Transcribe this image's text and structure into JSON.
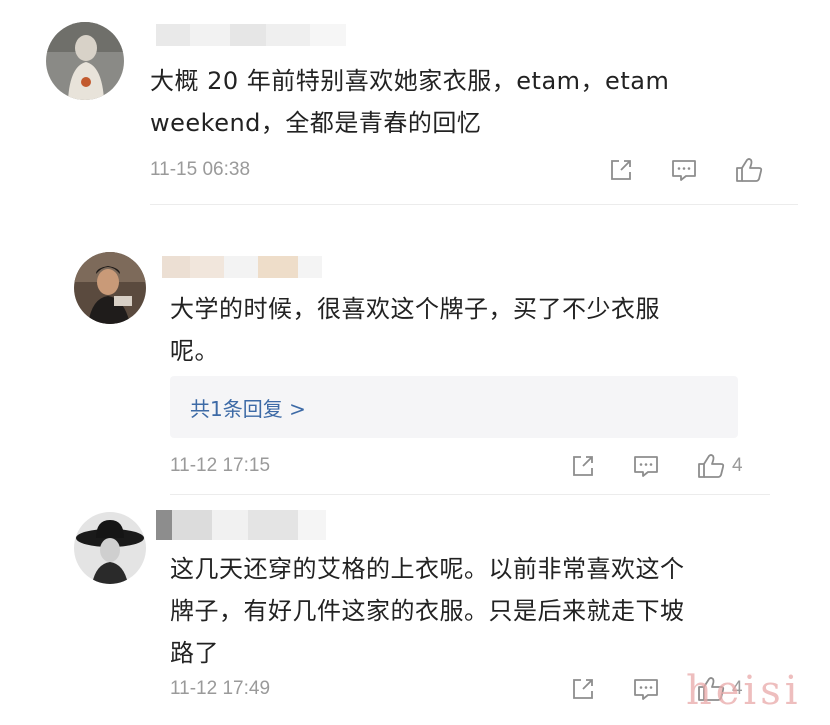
{
  "comments": [
    {
      "text_line1": "大概 20 年前特别喜欢她家衣服，etam，etam",
      "text_line2": "weekend，全都是青春的回忆",
      "time": "11-15 06:38",
      "likes": ""
    },
    {
      "text_line1": "大学的时候，很喜欢这个牌子，买了不少衣服",
      "text_line2": "呢。",
      "reply_link": "共1条回复 >",
      "time": "11-12 17:15",
      "likes": "4"
    },
    {
      "text_line1": "这几天还穿的艾格的上衣呢。以前非常喜欢这个",
      "text_line2": "牌子，有好几件这家的衣服。只是后来就走下坡",
      "text_line3": "路了",
      "time": "11-12 17:49",
      "likes": "4"
    }
  ],
  "watermark": "heisi",
  "icons": {
    "share": "share-icon",
    "comment": "comment-icon",
    "like": "thumbs-up-icon"
  },
  "colors": {
    "text": "#222222",
    "meta": "#9a9a9a",
    "link": "#3d6aa6",
    "reply_bg": "#f5f5f7",
    "watermark": "#e9a9a9"
  }
}
